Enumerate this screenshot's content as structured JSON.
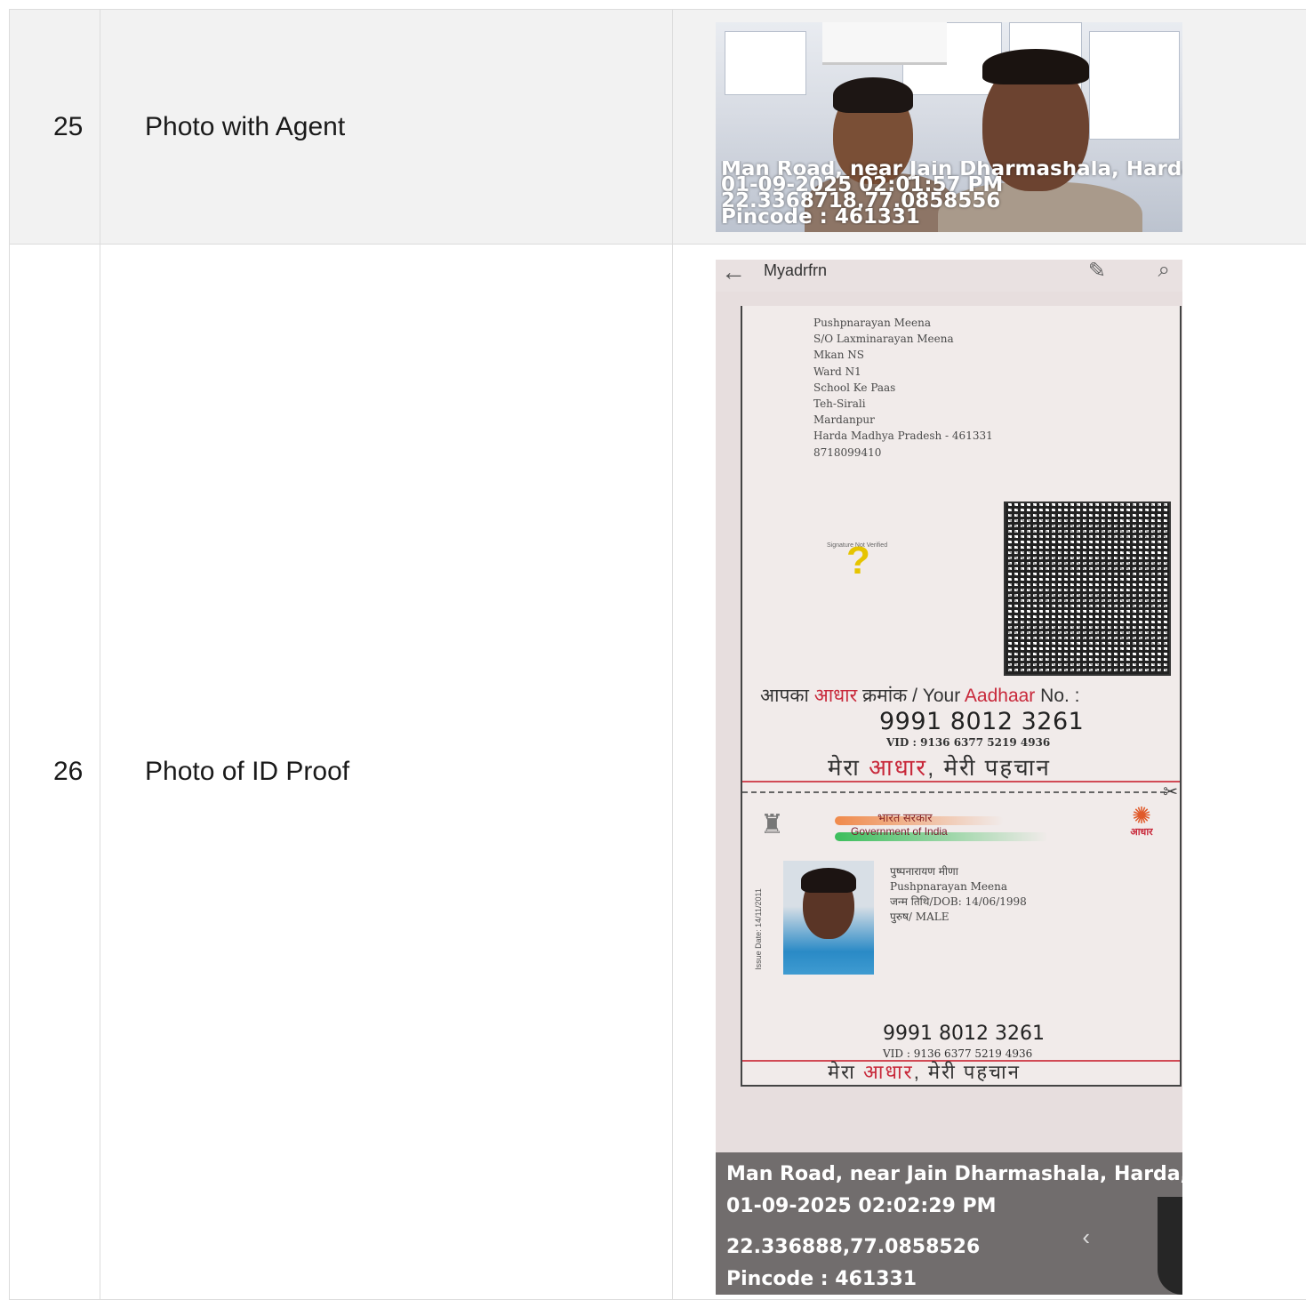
{
  "rows": [
    {
      "number": "25",
      "label": "Photo with Agent",
      "overlay": {
        "address": "Man Road, near Jain Dharmashala, Harda, ...",
        "datetime": "01-09-2025 02:01:57 PM",
        "coords": "22.3368718,77.0858556",
        "pincode": "Pincode : 461331"
      }
    },
    {
      "number": "26",
      "label": "Photo of ID Proof",
      "app_bar": {
        "title": "Myadrfrn",
        "back_icon": "arrow-left-icon",
        "edit_icon": "pencil-icon",
        "search_icon": "search-icon"
      },
      "id_card": {
        "address_lines": [
          "Pushpnarayan Meena",
          "S/O Laxminarayan Meena",
          "Mkan NS",
          "Ward N1",
          "School Ke Paas",
          "Teh-Sirali",
          "Mardanpur",
          "Harda Madhya Pradesh - 461331",
          "8718099410"
        ],
        "signature_label": "Signature Not Verified",
        "aadhaar_prefix": "आपका ",
        "aadhaar_word_hi": "आधार",
        "aadhaar_mid": " क्रमांक / Your ",
        "aadhaar_word_en": "Aadhaar",
        "aadhaar_suffix": " No. :",
        "aadhaar_number": "9991 8012 3261",
        "vid": "VID : 9136 6377 5219 4936",
        "tagline_pre": "मेरा ",
        "tagline_word": "आधार",
        "tagline_post": ", मेरी पहचान",
        "gov_hindi": "भारत सरकार",
        "gov_english": "Government of India",
        "aadhaar_logo_text": "आधार",
        "issue_date": "Issue Date: 14/11/2011",
        "holder_name_hi": "पुष्पनारायण मीणा",
        "holder_name": "Pushpnarayan Meena",
        "dob": "जन्म तिथि/DOB: 14/06/1998",
        "gender": "पुरुष/ MALE"
      },
      "overlay": {
        "address": "Man Road, near Jain Dharmashala, Harda, ...",
        "datetime": "01-09-2025 02:02:29 PM",
        "coords": "22.336888,77.0858526",
        "pincode": "Pincode : 461331"
      }
    }
  ]
}
